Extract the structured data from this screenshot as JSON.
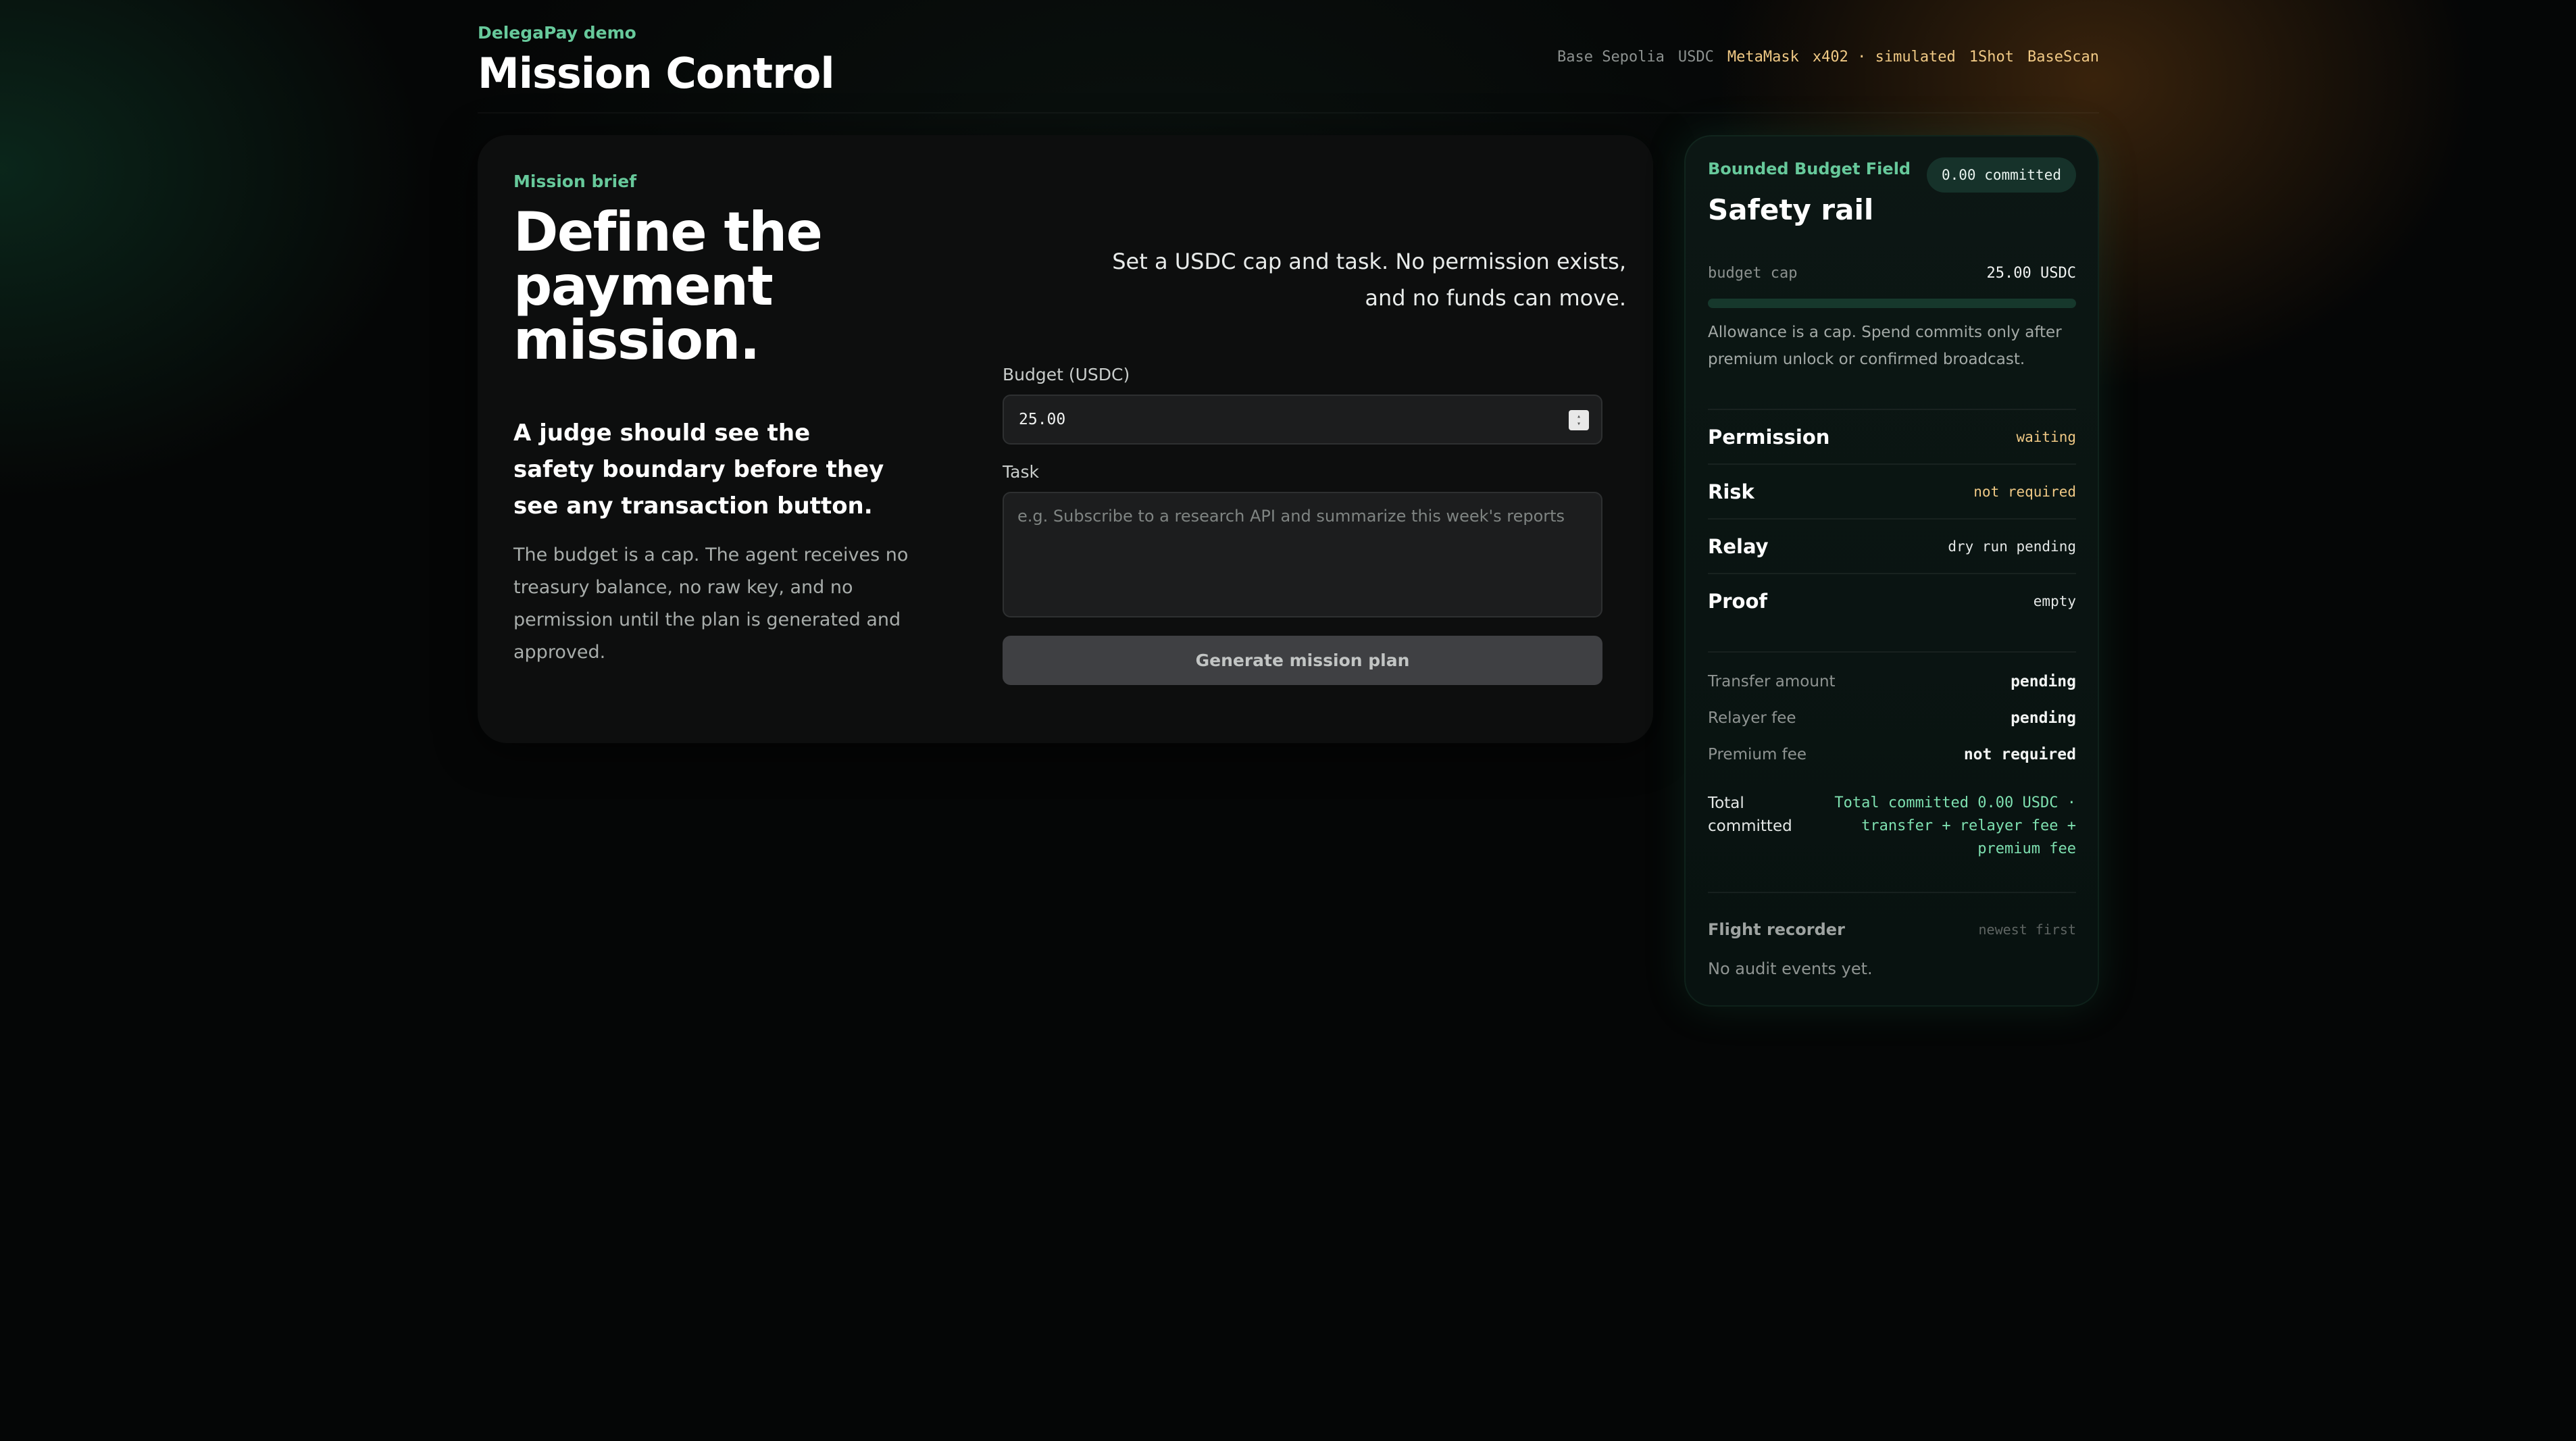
{
  "header": {
    "eyebrow": "DelegaPay demo",
    "title": "Mission Control",
    "chips": [
      {
        "label": "Base Sepolia",
        "tone": "dim"
      },
      {
        "label": "USDC",
        "tone": "dim"
      },
      {
        "label": "MetaMask",
        "tone": "amber"
      },
      {
        "label": "x402 · simulated",
        "tone": "amber"
      },
      {
        "label": "1Shot",
        "tone": "amber"
      },
      {
        "label": "BaseScan",
        "tone": "amber"
      }
    ]
  },
  "mission": {
    "eyebrow": "Mission brief",
    "title": "Define the payment mission.",
    "description": "Set a USDC cap and task. No permission exists, and no funds can move.",
    "subhead": "A judge should see the safety boundary before they see any transaction button.",
    "body": "The budget is a cap. The agent receives no treasury balance, no raw key, and no permission until the plan is generated and approved.",
    "budget_label": "Budget (USDC)",
    "budget_value": "25.00",
    "task_label": "Task",
    "task_placeholder": "e.g. Subscribe to a research API and summarize this week's reports",
    "generate_button": "Generate mission plan"
  },
  "rail": {
    "eyebrow": "Bounded Budget Field",
    "badge": "0.00 committed",
    "title": "Safety rail",
    "cap_label": "budget cap",
    "cap_value": "25.00 USDC",
    "cap_committed_fraction": 0,
    "cap_note": "Allowance is a cap. Spend commits only after premium unlock or confirmed broadcast.",
    "statuses": [
      {
        "label": "Permission",
        "value": "waiting",
        "color": "#f0c985"
      },
      {
        "label": "Risk",
        "value": "not required",
        "color": "#f0c985"
      },
      {
        "label": "Relay",
        "value": "dry run pending",
        "color": "#e4e7e6"
      },
      {
        "label": "Proof",
        "value": "empty",
        "color": "#e4e7e6"
      }
    ],
    "fees": [
      {
        "label": "Transfer amount",
        "value": "pending"
      },
      {
        "label": "Relayer fee",
        "value": "pending"
      },
      {
        "label": "Premium fee",
        "value": "not required"
      }
    ],
    "total_label": "Total committed",
    "total_value": "Total committed 0.00 USDC · transfer + relayer fee + premium fee",
    "recorder_label": "Flight recorder",
    "recorder_order": "newest first",
    "recorder_empty": "No audit events yet."
  },
  "colors": {
    "accent_green": "#67c99b",
    "accent_amber": "#f0c985",
    "background": "#050606"
  },
  "icons": {
    "budget_stepper": "stepper-icon"
  }
}
